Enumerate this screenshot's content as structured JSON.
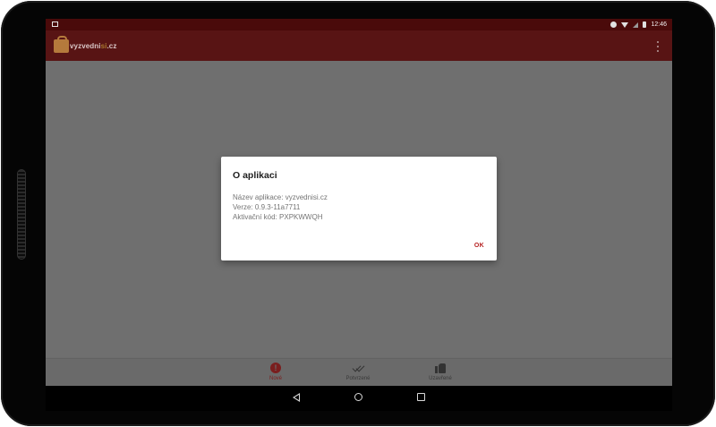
{
  "status_bar": {
    "time": "12:46"
  },
  "app_bar": {
    "logo_text_main": "vyzvedni",
    "logo_text_accent": "si",
    "logo_text_suffix": ".cz",
    "overflow_icon": "more-vert-icon"
  },
  "dialog": {
    "title": "O aplikaci",
    "lines": [
      "Název aplikace: vyzvednisi.cz",
      "Verze: 0.9.3-11a7711",
      "Aktivační kód: PXPKWWQH"
    ],
    "ok_label": "OK"
  },
  "bottom_nav": {
    "items": [
      {
        "label": "Nové",
        "icon": "alert-icon",
        "active": true
      },
      {
        "label": "Potvrzené",
        "icon": "double-check-icon",
        "active": false
      },
      {
        "label": "Uzavřené",
        "icon": "thumb-up-icon",
        "active": false
      }
    ]
  },
  "system_nav": {
    "back": "back-icon",
    "home": "home-icon",
    "recents": "recents-icon"
  },
  "colors": {
    "app_bar": "#581414",
    "status_bar": "#4a0a0a",
    "accent": "#b52020",
    "scrim": "#6f6f6f"
  }
}
